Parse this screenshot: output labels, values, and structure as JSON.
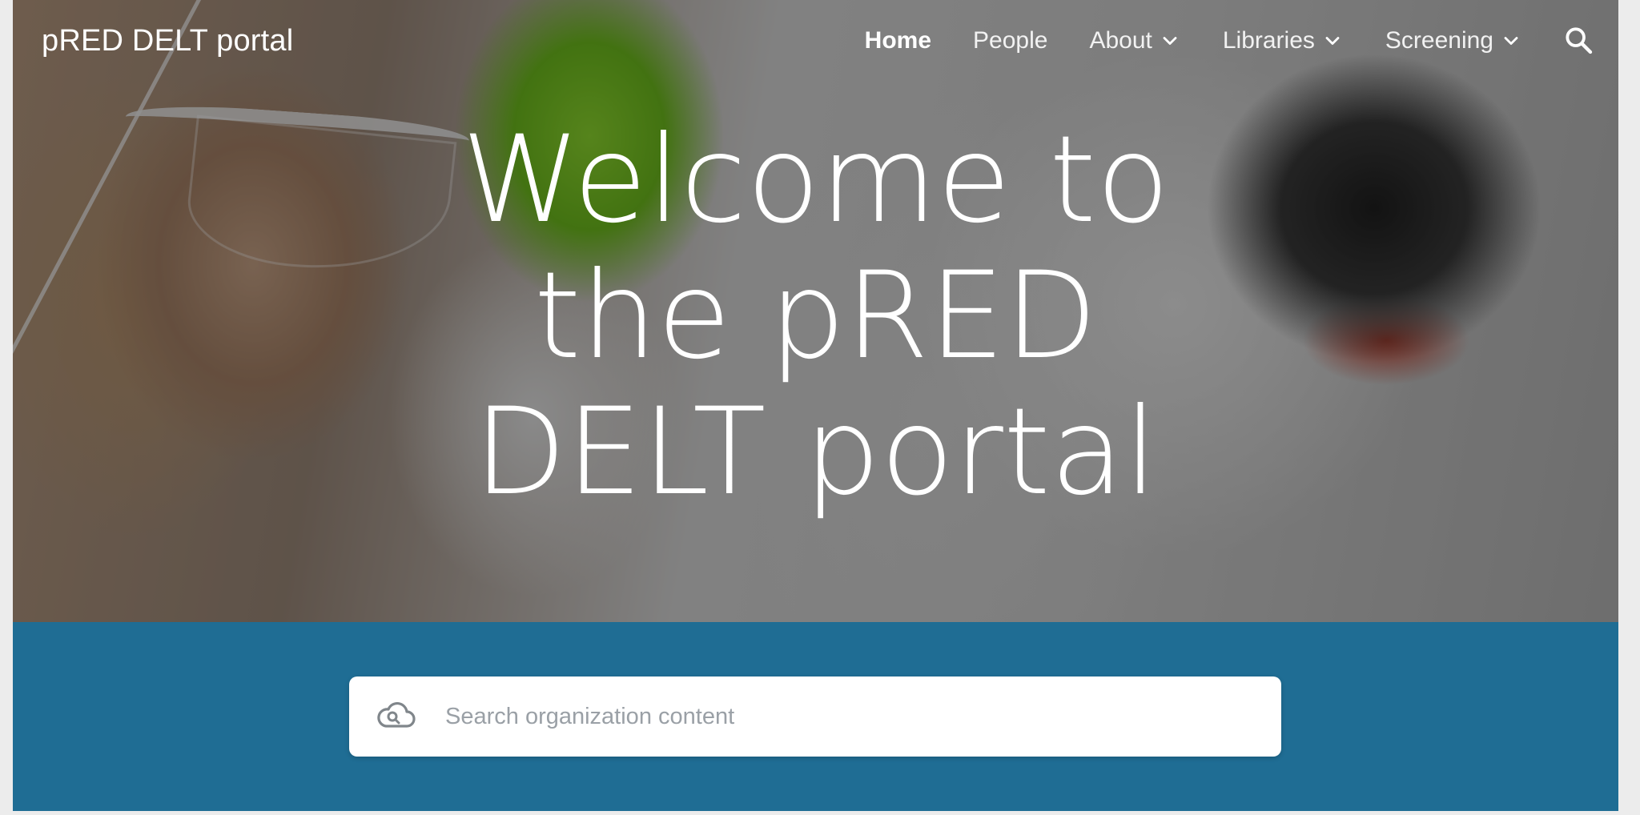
{
  "site": {
    "title": "pRED DELT portal"
  },
  "nav": {
    "items": [
      {
        "label": "Home",
        "active": true,
        "has_dropdown": false
      },
      {
        "label": "People",
        "active": false,
        "has_dropdown": false
      },
      {
        "label": "About",
        "active": false,
        "has_dropdown": true
      },
      {
        "label": "Libraries",
        "active": false,
        "has_dropdown": true
      },
      {
        "label": "Screening",
        "active": false,
        "has_dropdown": true
      }
    ],
    "search_icon": "search-icon",
    "dropdown_icon": "chevron-down-icon"
  },
  "hero": {
    "heading_lines": [
      "Welcome to",
      "the pRED",
      "DELT portal"
    ]
  },
  "search": {
    "placeholder": "Search organization content",
    "value": "",
    "icon": "cloud-search-icon"
  },
  "colors": {
    "search_band": "#1f6d94",
    "text_on_hero": "#ffffff"
  }
}
